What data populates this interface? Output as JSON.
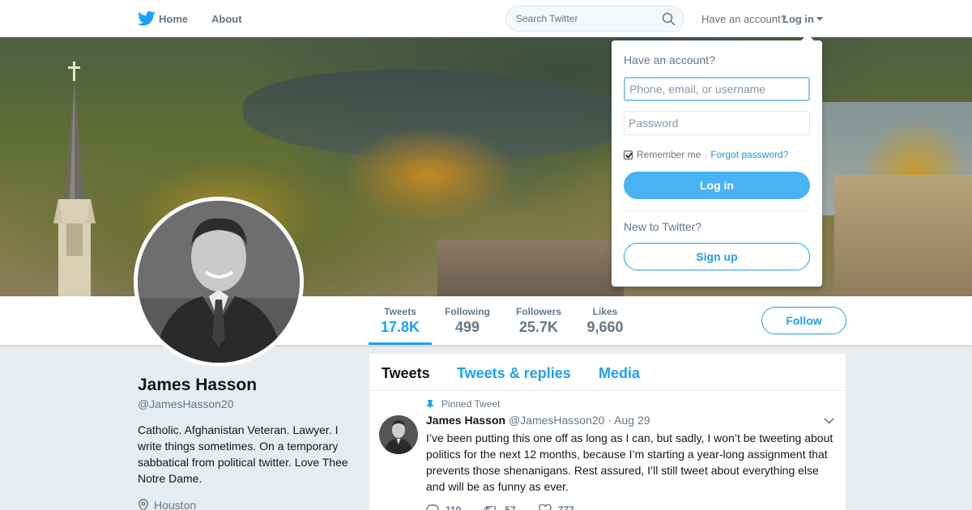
{
  "nav": {
    "home_label": "Home",
    "about_label": "About",
    "search_placeholder": "Search Twitter",
    "have_account": "Have an account?",
    "login_label": "Log in"
  },
  "profile": {
    "name": "James Hasson",
    "handle": "@JamesHasson20",
    "bio": "Catholic. Afghanistan Veteran. Lawyer. I write things sometimes. On a temporary sabbatical from political twitter. Love Thee Notre Dame.",
    "location": "Houston"
  },
  "stats": [
    {
      "label": "Tweets",
      "value": "17.8K"
    },
    {
      "label": "Following",
      "value": "499"
    },
    {
      "label": "Followers",
      "value": "25.7K"
    },
    {
      "label": "Likes",
      "value": "9,660"
    }
  ],
  "follow_label": "Follow",
  "tabs": [
    "Tweets",
    "Tweets & replies",
    "Media"
  ],
  "tweet": {
    "pinned_label": "Pinned Tweet",
    "name": "James Hasson",
    "handle": "@JamesHasson20",
    "separator": "·",
    "time": "Aug 29",
    "text": "I’ve been putting this one off as long as I can, but sadly, I won’t be tweeting about politics for the next 12 months, because I’m starting a year-long assignment that prevents those shenanigans. Rest assured, I’ll still tweet about everything else and will be as funny as ever.",
    "replies": "110",
    "retweets": "57",
    "likes": "777"
  },
  "login_dropdown": {
    "title": "Have an account?",
    "username_placeholder": "Phone, email, or username",
    "password_placeholder": "Password",
    "remember_label": "Remember me",
    "separator": "·",
    "forgot_label": "Forgot password?",
    "login_button": "Log in",
    "new_label": "New to Twitter?",
    "signup_button": "Sign up"
  },
  "colors": {
    "accent": "#1da1f2",
    "login_button_bg": "#4ab3f4",
    "page_bg": "#e6ecf0"
  },
  "icons": [
    "twitter-bird-icon",
    "search-icon",
    "caret-down-icon",
    "pin-icon",
    "location-icon",
    "chevron-down-icon",
    "reply-icon",
    "retweet-icon",
    "heart-icon"
  ]
}
